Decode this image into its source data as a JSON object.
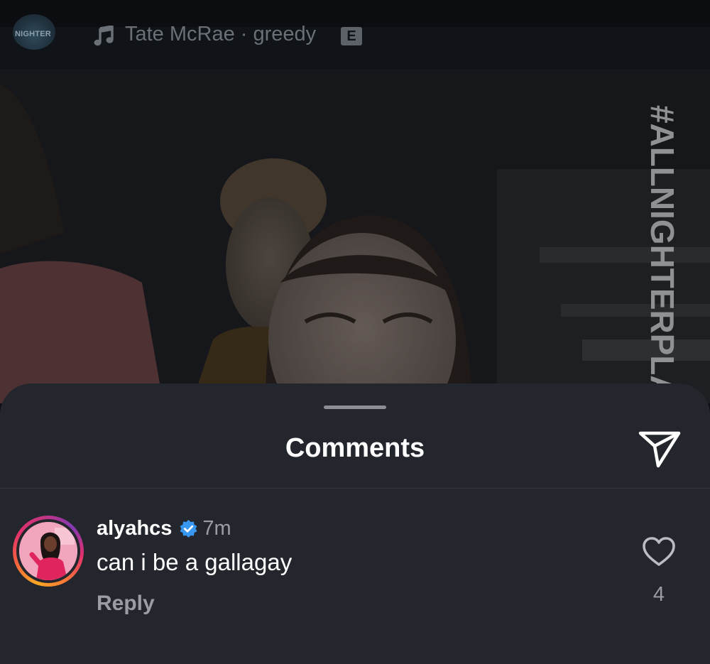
{
  "music_bar": {
    "profile_thumb_text": "NIGHTER",
    "music_icon": "music-note-icon",
    "track_text": "Tate McRae · greedy",
    "explicit_badge": "E"
  },
  "video": {
    "overlay_hashtag": "#ALLNIGHTERPLAY"
  },
  "comments_sheet": {
    "title": "Comments",
    "share_icon": "send-icon",
    "comments": [
      {
        "username": "alyahcs",
        "verified": true,
        "verified_icon": "verified-badge-icon",
        "time": "7m",
        "text": "can i be a gallagay",
        "reply_label": "Reply",
        "like_icon": "heart-icon",
        "like_count": "4"
      }
    ]
  },
  "colors": {
    "sheet_background": "#24262d",
    "verified_blue": "#3897f0",
    "secondary_text": "#9a9da3"
  }
}
